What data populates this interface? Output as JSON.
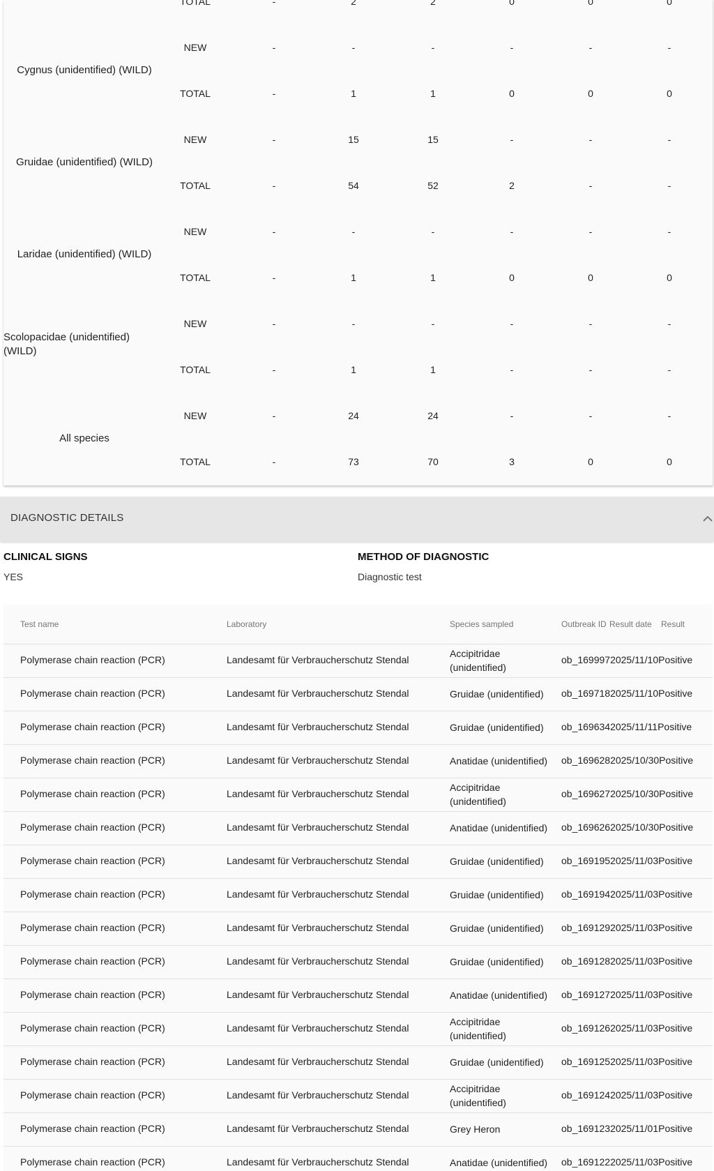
{
  "quantities": {
    "top_partial": {
      "type": "TOTAL",
      "values": [
        "-",
        "2",
        "2",
        "0",
        "0",
        "0"
      ]
    },
    "rows": [
      {
        "species": "Cygnus (unidentified) (WILD)",
        "new": [
          "-",
          "-",
          "-",
          "-",
          "-",
          "-"
        ],
        "total": [
          "-",
          "1",
          "1",
          "0",
          "0",
          "0"
        ]
      },
      {
        "species": "Gruidae (unidentified) (WILD)",
        "new": [
          "-",
          "15",
          "15",
          "-",
          "-",
          "-"
        ],
        "total": [
          "-",
          "54",
          "52",
          "2",
          "-",
          "-"
        ]
      },
      {
        "species": "Laridae (unidentified) (WILD)",
        "new": [
          "-",
          "-",
          "-",
          "-",
          "-",
          "-"
        ],
        "total": [
          "-",
          "1",
          "1",
          "0",
          "0",
          "0"
        ]
      },
      {
        "species": "Scolopacidae (unidentified) (WILD)",
        "new": [
          "-",
          "-",
          "-",
          "-",
          "-",
          "-"
        ],
        "total": [
          "-",
          "1",
          "1",
          "-",
          "-",
          "-"
        ]
      },
      {
        "species": "All species",
        "new": [
          "-",
          "24",
          "24",
          "-",
          "-",
          "-"
        ],
        "total": [
          "-",
          "73",
          "70",
          "3",
          "0",
          "0"
        ]
      }
    ],
    "new_label": "NEW",
    "total_label": "TOTAL"
  },
  "diagnostic": {
    "section_title": "DIAGNOSTIC DETAILS",
    "clinical_signs_label": "CLINICAL SIGNS",
    "clinical_signs_value": "YES",
    "method_label": "METHOD OF DIAGNOSTIC",
    "method_value": "Diagnostic test",
    "icons": {
      "collapse": "chevron-up-icon"
    }
  },
  "tests": {
    "headers": [
      "Test name",
      "Laboratory",
      "Species sampled",
      "Outbreak ID",
      "Result date",
      "Result"
    ],
    "rows": [
      {
        "test": "Polymerase chain reaction (PCR)",
        "lab": "Landesamt für Verbraucherschutz Stendal",
        "species": "Accipitridae (unidentified)",
        "outbreak": "ob_169997",
        "date": "2025/11/10",
        "result": "Positive"
      },
      {
        "test": "Polymerase chain reaction (PCR)",
        "lab": "Landesamt für Verbraucherschutz Stendal",
        "species": "Gruidae (unidentified)",
        "outbreak": "ob_169718",
        "date": "2025/11/10",
        "result": "Positive"
      },
      {
        "test": "Polymerase chain reaction (PCR)",
        "lab": "Landesamt für Verbraucherschutz Stendal",
        "species": "Gruidae (unidentified)",
        "outbreak": "ob_169634",
        "date": "2025/11/11",
        "result": "Positive"
      },
      {
        "test": "Polymerase chain reaction (PCR)",
        "lab": "Landesamt für Verbraucherschutz Stendal",
        "species": "Anatidae (unidentified)",
        "outbreak": "ob_169628",
        "date": "2025/10/30",
        "result": "Positive"
      },
      {
        "test": "Polymerase chain reaction (PCR)",
        "lab": "Landesamt für Verbraucherschutz Stendal",
        "species": "Accipitridae (unidentified)",
        "outbreak": "ob_169627",
        "date": "2025/10/30",
        "result": "Positive"
      },
      {
        "test": "Polymerase chain reaction (PCR)",
        "lab": "Landesamt für Verbraucherschutz Stendal",
        "species": "Anatidae (unidentified)",
        "outbreak": "ob_169626",
        "date": "2025/10/30",
        "result": "Positive"
      },
      {
        "test": "Polymerase chain reaction (PCR)",
        "lab": "Landesamt für Verbraucherschutz Stendal",
        "species": "Gruidae (unidentified)",
        "outbreak": "ob_169195",
        "date": "2025/11/03",
        "result": "Positive"
      },
      {
        "test": "Polymerase chain reaction (PCR)",
        "lab": "Landesamt für Verbraucherschutz Stendal",
        "species": "Gruidae (unidentified)",
        "outbreak": "ob_169194",
        "date": "2025/11/03",
        "result": "Positive"
      },
      {
        "test": "Polymerase chain reaction (PCR)",
        "lab": "Landesamt für Verbraucherschutz Stendal",
        "species": "Gruidae (unidentified)",
        "outbreak": "ob_169129",
        "date": "2025/11/03",
        "result": "Positive"
      },
      {
        "test": "Polymerase chain reaction (PCR)",
        "lab": "Landesamt für Verbraucherschutz Stendal",
        "species": "Gruidae (unidentified)",
        "outbreak": "ob_169128",
        "date": "2025/11/03",
        "result": "Positive"
      },
      {
        "test": "Polymerase chain reaction (PCR)",
        "lab": "Landesamt für Verbraucherschutz Stendal",
        "species": "Anatidae (unidentified)",
        "outbreak": "ob_169127",
        "date": "2025/11/03",
        "result": "Positive"
      },
      {
        "test": "Polymerase chain reaction (PCR)",
        "lab": "Landesamt für Verbraucherschutz Stendal",
        "species": "Accipitridae (unidentified)",
        "outbreak": "ob_169126",
        "date": "2025/11/03",
        "result": "Positive"
      },
      {
        "test": "Polymerase chain reaction (PCR)",
        "lab": "Landesamt für Verbraucherschutz Stendal",
        "species": "Gruidae (unidentified)",
        "outbreak": "ob_169125",
        "date": "2025/11/03",
        "result": "Positive"
      },
      {
        "test": "Polymerase chain reaction (PCR)",
        "lab": "Landesamt für Verbraucherschutz Stendal",
        "species": "Accipitridae (unidentified)",
        "outbreak": "ob_169124",
        "date": "2025/11/03",
        "result": "Positive"
      },
      {
        "test": "Polymerase chain reaction (PCR)",
        "lab": "Landesamt für Verbraucherschutz Stendal",
        "species": "Grey Heron",
        "outbreak": "ob_169123",
        "date": "2025/11/01",
        "result": "Positive"
      },
      {
        "test": "Polymerase chain reaction (PCR)",
        "lab": "Landesamt für Verbraucherschutz Stendal",
        "species": "Anatidae (unidentified)",
        "outbreak": "ob_169122",
        "date": "2025/11/03",
        "result": "Positive"
      }
    ]
  }
}
